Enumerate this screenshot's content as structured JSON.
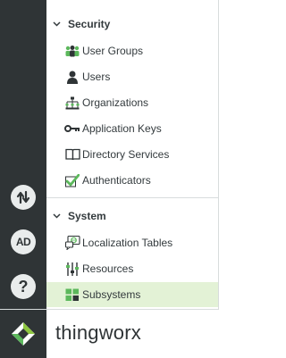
{
  "colors": {
    "rail_bg": "#2f3436",
    "selected_bg": "#e3f2d6",
    "accent_green": "#5cb85c",
    "text": "#333a3d"
  },
  "rail": {
    "buttons": [
      {
        "icon": "transfer-arrows-icon",
        "label": ""
      },
      {
        "icon": "ad-badge-icon",
        "label": "AD"
      },
      {
        "icon": "help-icon",
        "label": "?"
      }
    ]
  },
  "security": {
    "title": "Security",
    "items": [
      {
        "label": "User Groups",
        "icon": "user-groups-icon"
      },
      {
        "label": "Users",
        "icon": "user-icon"
      },
      {
        "label": "Organizations",
        "icon": "organization-tree-icon"
      },
      {
        "label": "Application Keys",
        "icon": "key-icon"
      },
      {
        "label": "Directory Services",
        "icon": "book-icon"
      },
      {
        "label": "Authenticators",
        "icon": "checkmark-icon"
      }
    ]
  },
  "system": {
    "title": "System",
    "items": [
      {
        "label": "Localization Tables",
        "icon": "localization-icon"
      },
      {
        "label": "Resources",
        "icon": "sliders-icon"
      },
      {
        "label": "Subsystems",
        "icon": "subsystems-icon",
        "selected": true
      }
    ]
  },
  "brand": {
    "name": "thingworx",
    "logo": "thingworx-logo-icon"
  }
}
